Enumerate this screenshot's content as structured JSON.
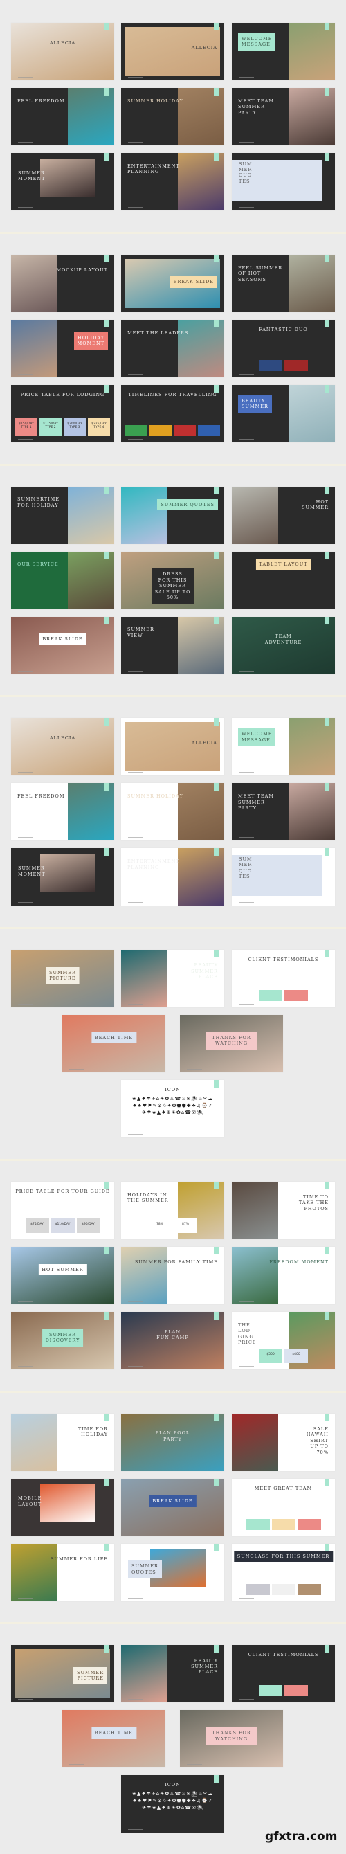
{
  "colors": {
    "page_bg": "#ebebeb",
    "dark": "#2b2b2b",
    "light": "#ffffff",
    "mint": "#a6e6cf",
    "separator": "#f3f0e2"
  },
  "watermark": "gfxtra.com",
  "sections": [
    {
      "slides": [
        {
          "title": "ALLECIA",
          "bg": "#f4efe9",
          "photo": [
            "#e9e2da",
            "#c9a47a"
          ],
          "color": "#333333"
        },
        {
          "title": "ALLECIA",
          "bg": "#2b2b2b",
          "photo": [
            "#d8bb96",
            "#c9a27a"
          ],
          "color": "#3a3a3a"
        },
        {
          "title": "WELCOME\nMESSAGE",
          "bg": "#2b2b2b",
          "photo": [
            "#8aa070",
            "#c9a27a"
          ],
          "box": "#a6e6cf",
          "color": "#3b5a4a"
        },
        {
          "title": "FEEL FREEDOM",
          "bg": "#2b2b2b",
          "photo": [
            "#5a7f6f",
            "#2aa7c0"
          ],
          "color": "#eeeeee"
        },
        {
          "title": "SUMMER HOLIDAY",
          "bg": "#2b2b2b",
          "photo": [
            "#a08060",
            "#7a5d44"
          ],
          "color": "#e9d8c0"
        },
        {
          "title": "MEET TEAM\nSUMMER\nPARTY",
          "bg": "#2b2b2b",
          "photo": [
            "#c8a9a0",
            "#4a3a35"
          ],
          "color": "#eeeeee"
        },
        {
          "title": "SUMMER\nMOMENT",
          "bg": "#2b2b2b",
          "photo": [
            "#c9b0a0",
            "#3a2e2e"
          ],
          "color": "#eeeeee"
        },
        {
          "title": "ENTERTAINMENT\nPLANNING",
          "bg": "#2b2b2b",
          "photo": [
            "#c9a060",
            "#4b3a6a"
          ],
          "color": "#eeeeee"
        },
        {
          "title": "SUM\nMER\nQUO\nTES",
          "bg": "#2b2b2b",
          "photo": [
            "#dbe3f0",
            "#dbe3f0"
          ],
          "color": "#555555"
        }
      ]
    },
    {
      "slides": [
        {
          "title": "MOCKUP LAYOUT",
          "bg": "#2b2b2b",
          "photo": [
            "#c7b6a8",
            "#6d5a5a"
          ],
          "color": "#eeeeee"
        },
        {
          "title": "BREAK SLIDE",
          "bg": "#2b2b2b",
          "photo": [
            "#d9c9b0",
            "#2e8fb0"
          ],
          "box": "#f6dcaa",
          "color": "#5a4630"
        },
        {
          "title": "FEEL SUMMER\nOF HOT\nSEASONS",
          "bg": "#2b2b2b",
          "photo": [
            "#b0b2a0",
            "#6a5a4a"
          ],
          "color": "#eeeeee"
        },
        {
          "title": "HOLIDAY\nMOMENT",
          "bg": "#2b2b2b",
          "photo": [
            "#5a7aa0",
            "#c49a7a"
          ],
          "box": "#ec7a72",
          "color": "#ffffff"
        },
        {
          "title": "MEET THE LEADERS",
          "bg": "#2b2b2b",
          "photo": [
            "#4aa0a0",
            "#c08a80"
          ],
          "color": "#eeeeee"
        },
        {
          "title": "FANTASTIC DUO",
          "bg": "#2b2b2b",
          "color": "#eeeeee",
          "extras": [
            {
              "text": "",
              "bg": "#2e4a80"
            },
            {
              "text": "",
              "bg": "#a02828"
            }
          ]
        },
        {
          "title": "PRICE TABLE FOR LODGING",
          "bg": "#2b2b2b",
          "color": "#eeeeee",
          "extras": [
            {
              "text": "$150/DAY\nTYPE 1",
              "bg": "#ec8a86"
            },
            {
              "text": "$175/DAY\nTYPE 2",
              "bg": "#a6e6cf"
            },
            {
              "text": "$200/DAY\nTYPE 3",
              "bg": "#b4c4e4"
            },
            {
              "text": "$225/DAY\nTYPE 4",
              "bg": "#f6dcaa"
            }
          ]
        },
        {
          "title": "TIMELINES FOR TRAVELLING",
          "bg": "#2b2b2b",
          "color": "#eeeeee",
          "extras": [
            {
              "text": "",
              "bg": "#3aa050"
            },
            {
              "text": "",
              "bg": "#e0a020"
            },
            {
              "text": "",
              "bg": "#c03030"
            },
            {
              "text": "",
              "bg": "#3060b0"
            }
          ]
        },
        {
          "title": "BEAUTY\nSUMMER",
          "bg": "#2b2b2b",
          "photo": [
            "#c0d4d8",
            "#8fb0b8"
          ],
          "box": "#4a6fc0",
          "color": "#ffffff"
        }
      ]
    },
    {
      "slides": [
        {
          "title": "SUMMERTIME\nFOR HOLIDAY",
          "bg": "#2b2b2b",
          "photo": [
            "#7fb2d8",
            "#d9c8a8"
          ],
          "color": "#eeeeee"
        },
        {
          "title": "SUMMER QUOTES",
          "bg": "#2b2b2b",
          "photo": [
            "#30b8c0",
            "#b8c0e0"
          ],
          "box": "#a6e6cf",
          "color": "#2f5a48"
        },
        {
          "title": "HOT\nSUMMER",
          "bg": "#2b2b2b",
          "photo": [
            "#b8b8b0",
            "#6a5a50"
          ],
          "color": "#eeeeee"
        },
        {
          "title": "OUR SERVICE",
          "bg": "#1f6b3c",
          "photo": [
            "#7aa060",
            "#5a4a3a"
          ],
          "color": "#a6e6cf"
        },
        {
          "title": "DRESS\nFOR THIS\nSUMMER\nSALE UP TO\n50%",
          "bg": "#2b2b2b",
          "photo": [
            "#c0a080",
            "#6a7a60"
          ],
          "box": "#2b2b2b",
          "color": "#eeeeee"
        },
        {
          "title": "TABLET LAYOUT",
          "bg": "#2b2b2b",
          "box": "#f6dcaa",
          "color": "#4a3a2a"
        },
        {
          "title": "BREAK SLIDE",
          "bg": "#2b2b2b",
          "photo": [
            "#8a5a50",
            "#c8a090"
          ],
          "box": "#ffffff",
          "color": "#333333"
        },
        {
          "title": "SUMMER\nVIEW",
          "bg": "#2b2b2b",
          "photo": [
            "#d8c8a8",
            "#5a6a7a"
          ],
          "color": "#eeeeee"
        },
        {
          "title": "TEAM ADVENTURE",
          "bg": "#1e3a30",
          "photo": [
            "#2f5a48",
            "#1e3a30"
          ],
          "color": "#d8e8e0"
        }
      ]
    },
    {
      "slides": [
        {
          "title": "ALLECIA",
          "bg": "#f4efe9",
          "photo": [
            "#e9e2da",
            "#c9a47a"
          ],
          "color": "#333333"
        },
        {
          "title": "ALLECIA",
          "bg": "#ffffff",
          "photo": [
            "#d8bb96",
            "#c9a27a"
          ],
          "color": "#3a3a3a"
        },
        {
          "title": "WELCOME\nMESSAGE",
          "bg": "#ffffff",
          "photo": [
            "#8aa070",
            "#c9a27a"
          ],
          "box": "#a6e6cf",
          "color": "#3b5a4a"
        },
        {
          "title": "FEEL FREEDOM",
          "bg": "#ffffff",
          "photo": [
            "#5a7f6f",
            "#2aa7c0"
          ],
          "color": "#333333"
        },
        {
          "title": "SUMMER HOLIDAY",
          "bg": "#ffffff",
          "photo": [
            "#a08060",
            "#7a5d44"
          ],
          "color": "#e9d8c0"
        },
        {
          "title": "MEET TEAM\nSUMMER\nPARTY",
          "bg": "#2b2b2b",
          "photo": [
            "#c8a9a0",
            "#4a3a35"
          ],
          "color": "#eeeeee"
        },
        {
          "title": "SUMMER\nMOMENT",
          "bg": "#2b2b2b",
          "photo": [
            "#c9b0a0",
            "#3a2e2e"
          ],
          "color": "#eeeeee"
        },
        {
          "title": "ENTERTAINMENT\nPLANNING",
          "bg": "#ffffff",
          "photo": [
            "#c9a060",
            "#4b3a6a"
          ],
          "color": "#eeeeee"
        },
        {
          "title": "SUM\nMER\nQUO\nTES",
          "bg": "#ffffff",
          "photo": [
            "#dbe3f0",
            "#dbe3f0"
          ],
          "color": "#555555"
        }
      ]
    },
    {
      "slides": [
        {
          "title": "SUMMER\nPICTURE",
          "bg": "#ffffff",
          "photo": [
            "#c8a070",
            "#7a8a90"
          ],
          "box": "#f3efe3",
          "color": "#5a4630"
        },
        {
          "title": "BEAUTY\nSUMMER\nPLACE",
          "bg": "#ffffff",
          "photo": [
            "#1e6a70",
            "#e0a090"
          ],
          "color": "#e8f0e8"
        },
        {
          "title": "CLIENT TESTIMONIALS",
          "bg": "#ffffff",
          "color": "#333333",
          "extras": [
            {
              "text": "",
              "bg": "#a6e6cf"
            },
            {
              "text": "",
              "bg": "#ec8a86"
            }
          ]
        },
        {
          "title": "BEACH TIME",
          "bg": "#f2c9c6",
          "photo": [
            "#e07a60",
            "#c8b8a8"
          ],
          "box": "#dbe3f0",
          "color": "#444444"
        },
        {
          "title": "THANKS FOR WATCHING",
          "bg": "#6a6a60",
          "photo": [
            "#6a6a60",
            "#d8c0b0"
          ],
          "box": "#f4c9c9",
          "color": "#555555"
        },
        {
          "title": "ICON",
          "bg": "#ffffff",
          "color": "#222222",
          "icons": "★▲♦☂✈⌂☀✿⚓☎♨✉⛱☕✂☁♠♣♥⚑✎⚙☼✦✪⬟⬢✚☘♫⌚✓✈☂★▲♦⚓☀✿⌂☎✉⛱"
        }
      ]
    },
    {
      "slides": [
        {
          "title": "PRICE TABLE FOR TOUR GUIDE",
          "bg": "#ffffff",
          "color": "#333333",
          "extras": [
            {
              "text": "$75/DAY",
              "bg": "#d8d8d8"
            },
            {
              "text": "$110/DAY",
              "bg": "#d8dce8"
            },
            {
              "text": "$90/DAY",
              "bg": "#d8d8d8"
            }
          ]
        },
        {
          "title": "HOLIDAYS IN\nTHE SUMMER",
          "bg": "#ffffff",
          "photo": [
            "#c0a030",
            "#d8c8b0"
          ],
          "color": "#333333",
          "extras": [
            {
              "text": "78%",
              "bg": "#ffffff"
            },
            {
              "text": "87%",
              "bg": "#ffffff"
            }
          ]
        },
        {
          "title": "TIME TO\nTAKE THE\nPHOTOS",
          "bg": "#ffffff",
          "photo": [
            "#5a4a40",
            "#8a9090"
          ],
          "color": "#333333"
        },
        {
          "title": "HOT SUMMER",
          "bg": "#a8c8e8",
          "photo": [
            "#a8c8e8",
            "#2a4a30"
          ],
          "box": "#ffffff",
          "color": "#333333"
        },
        {
          "title": "SUMMER FOR FAMILY TIME",
          "bg": "#ffffff",
          "photo": [
            "#e0d0b0",
            "#5aa0c0"
          ],
          "color": "#333333"
        },
        {
          "title": "FREEDOM MOMENT",
          "bg": "#ffffff",
          "photo": [
            "#8cc0d0",
            "#3a6a40"
          ],
          "color": "#2f5a48"
        },
        {
          "title": "SUMMER\nDISCOVERY",
          "bg": "#ffffff",
          "photo": [
            "#8a6a50",
            "#d8c8b0"
          ],
          "box": "#a6e6cf",
          "color": "#2f5a48"
        },
        {
          "title": "PLAN\nFUN CAMP",
          "bg": "#2b2b2b",
          "photo": [
            "#2a3a50",
            "#c08060"
          ],
          "color": "#eeeeee"
        },
        {
          "title": "THE\nLOD\nGING\nPRICE",
          "bg": "#ffffff",
          "photo": [
            "#5a9a60",
            "#c08a60"
          ],
          "color": "#555555",
          "extras": [
            {
              "text": "$500",
              "bg": "#a6e6cf"
            },
            {
              "text": "$400",
              "bg": "#dbe3f0"
            }
          ]
        }
      ]
    },
    {
      "slides": [
        {
          "title": "TIME FOR\nHOLIDAY",
          "bg": "#ffffff",
          "photo": [
            "#b8d0e0",
            "#d8c0a0"
          ],
          "color": "#333333"
        },
        {
          "title": "PLAN POOL\nPARTY",
          "bg": "#2b2b2b",
          "photo": [
            "#8a7040",
            "#3aa0c0"
          ],
          "color": "#eeeeee"
        },
        {
          "title": "SALE\nHAWAII\nSHIRT\nUP TO\n70%",
          "bg": "#ffffff",
          "photo": [
            "#a02828",
            "#4a5a50"
          ],
          "color": "#333333"
        },
        {
          "title": "MOBILE\nLAYOUT",
          "bg": "#3a3535",
          "photo": [
            "#e05a30",
            "#ffffff"
          ],
          "color": "#eeeeee"
        },
        {
          "title": "BREAK SLIDE",
          "bg": "#8aa0b0",
          "photo": [
            "#8aa0b0",
            "#8a7060"
          ],
          "box": "#3a5aa0",
          "color": "#ffffff"
        },
        {
          "title": "MEET GREAT TEAM",
          "bg": "#ffffff",
          "color": "#333333",
          "extras": [
            {
              "text": "",
              "bg": "#a6e6cf"
            },
            {
              "text": "",
              "bg": "#f6dcaa"
            },
            {
              "text": "",
              "bg": "#ec8a86"
            }
          ]
        },
        {
          "title": "SUMMER FOR LIFE",
          "bg": "#ffffff",
          "photo": [
            "#c0a030",
            "#3a7a50"
          ],
          "color": "#333333"
        },
        {
          "title": "SUMMER\nQUOTES",
          "bg": "#ffffff",
          "photo": [
            "#40a8d8",
            "#e07030"
          ],
          "box": "#dbe3f0",
          "color": "#444444"
        },
        {
          "title": "SUNGLASS FOR THIS SUMMER",
          "bg": "#ffffff",
          "box": "#2a2f3a",
          "color": "#eeeeee",
          "extras": [
            {
              "text": "",
              "bg": "#c8c8d0"
            },
            {
              "text": "",
              "bg": "#f0f0f0"
            },
            {
              "text": "",
              "bg": "#b09070"
            }
          ]
        }
      ]
    },
    {
      "slides": [
        {
          "title": "SUMMER\nPICTURE",
          "bg": "#2b2b2b",
          "photo": [
            "#c8a070",
            "#7a8a90"
          ],
          "box": "#f3efe3",
          "color": "#5a4630"
        },
        {
          "title": "BEAUTY\nSUMMER\nPLACE",
          "bg": "#2b2b2b",
          "photo": [
            "#1e6a70",
            "#e0a090"
          ],
          "color": "#e8f0e8"
        },
        {
          "title": "CLIENT TESTIMONIALS",
          "bg": "#2b2b2b",
          "color": "#eeeeee",
          "extras": [
            {
              "text": "",
              "bg": "#a6e6cf"
            },
            {
              "text": "",
              "bg": "#ec8a86"
            }
          ]
        },
        {
          "title": "BEACH TIME",
          "bg": "#f2c9c6",
          "photo": [
            "#e07a60",
            "#c8b8a8"
          ],
          "box": "#dbe3f0",
          "color": "#444444"
        },
        {
          "title": "THANKS FOR WATCHING",
          "bg": "#6a6a60",
          "photo": [
            "#6a6a60",
            "#d8c0b0"
          ],
          "box": "#f4c9c9",
          "color": "#555555"
        },
        {
          "title": "ICON",
          "bg": "#2b2b2b",
          "color": "#eeeeee",
          "icons": "★▲♦☂✈⌂☀✿⚓☎♨✉⛱☕✂☁♠♣♥⚑✎⚙☼✦✪⬟⬢✚☘♫⌚✓✈☂★▲♦⚓☀✿⌂☎✉⛱"
        }
      ]
    }
  ]
}
